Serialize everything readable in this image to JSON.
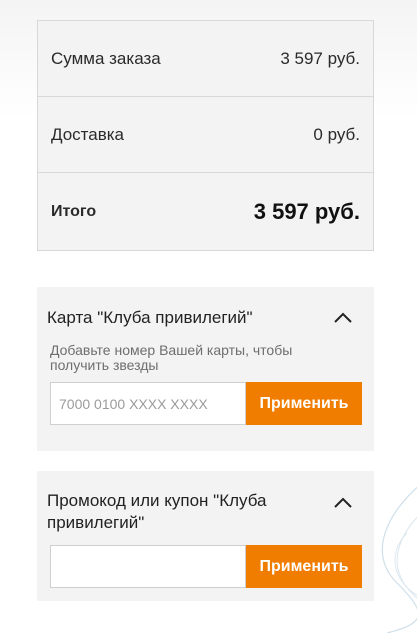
{
  "summary": {
    "order_sum_label": "Сумма заказа",
    "order_sum_value": "3 597 руб.",
    "delivery_label": "Доставка",
    "delivery_value": "0 руб.",
    "total_label": "Итого",
    "total_value": "3 597 руб."
  },
  "loyalty_card": {
    "title": "Карта \"Клуба привилегий\"",
    "hint": "Добавьте номер Вашей карты, чтобы получить звезды",
    "input_value": "",
    "input_placeholder": "7000 0100 XXXX XXXX",
    "apply_label": "Применить",
    "chevron_icon": "chevron-up-icon"
  },
  "promo": {
    "title": "Промокод или купон \"Клуба привилегий\"",
    "input_value": "",
    "input_placeholder": "",
    "apply_label": "Применить",
    "chevron_icon": "chevron-up-icon"
  },
  "colors": {
    "accent": "#f07d00",
    "panel_bg": "#f3f3f3",
    "border": "#d8d8d8"
  }
}
